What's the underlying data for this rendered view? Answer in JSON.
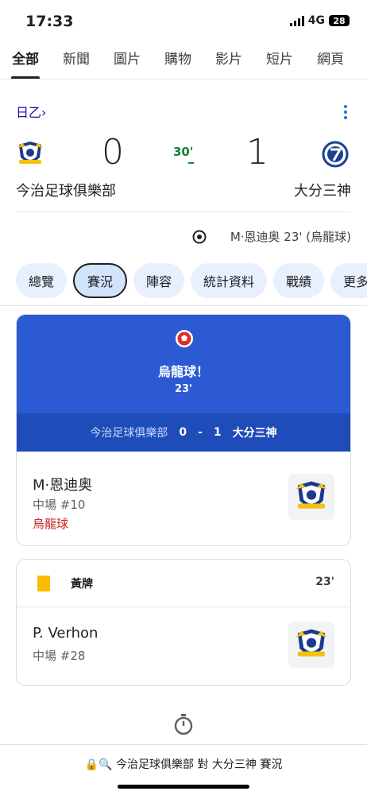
{
  "status_bar": {
    "time": "17:33",
    "network": "4G",
    "battery": "28"
  },
  "search_tabs": [
    "全部",
    "新聞",
    "圖片",
    "購物",
    "影片",
    "短片",
    "網頁"
  ],
  "match": {
    "league": "日乙",
    "league_arrow": "›",
    "home_team": "今治足球俱樂部",
    "away_team": "大分三神",
    "home_score": "0",
    "away_score": "1",
    "minute": "30'",
    "scorer_summary": "M·恩迪奥 23' (烏龍球)"
  },
  "match_chips": [
    "總覽",
    "賽況",
    "陣容",
    "統計資料",
    "戰績",
    "更多"
  ],
  "goal_event": {
    "title": "烏龍球！",
    "minute": "23'",
    "home": "今治足球俱樂部",
    "home_score": "0",
    "dash": "-",
    "away_score": "1",
    "away": "大分三神",
    "player": "M·恩迪奥",
    "position": "中場 #10",
    "note": "烏龍球"
  },
  "card_event": {
    "title": "黃牌",
    "minute": "23'",
    "player": "P. Verhon",
    "position": "中場 #28"
  },
  "bottom": {
    "url": "今治足球俱樂部 對 大分三神 賽況"
  },
  "colors": {
    "accent": "#1a73e8",
    "goal_banner": "#2c5ad2",
    "own_goal": "#c5221f",
    "yellow_card": "#fbbc04",
    "live_minute": "#188038"
  }
}
